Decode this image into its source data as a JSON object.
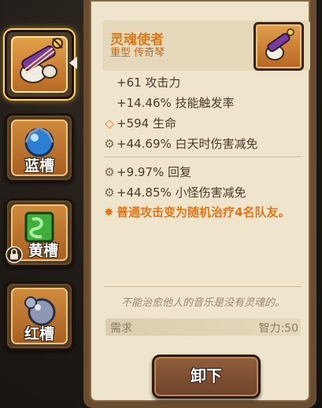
{
  "slots": [
    {
      "label": "",
      "icon": "lute-icon",
      "active": true
    },
    {
      "label": "蓝槽",
      "icon": "blue-gem-icon"
    },
    {
      "label": "黄槽",
      "icon": "green-gem-icon",
      "locked": true
    },
    {
      "label": "红槽",
      "icon": "gray-orb-icon"
    }
  ],
  "item": {
    "name": "灵魂使者",
    "type": "重型 传奇琴",
    "thumb_icon": "lute-icon"
  },
  "stats_main": [
    {
      "icon": "",
      "text": "+61 攻击力"
    },
    {
      "icon": "",
      "text": "+14.46% 技能触发率"
    },
    {
      "icon": "diamond-icon",
      "text": "+594 生命"
    },
    {
      "icon": "gear-icon",
      "text": "+44.69% 白天时伤害减免"
    }
  ],
  "stats_extra": [
    {
      "icon": "gear-icon",
      "text": "+9.97% 回复"
    },
    {
      "icon": "gear-icon",
      "text": "+44.85% 小怪伤害减免"
    }
  ],
  "special": {
    "icon": "star-icon",
    "text": "普通攻击变为随机治疗4名队友。"
  },
  "flavor": "不能治愈他人的音乐是没有灵魂的。",
  "requirement": {
    "label": "需求",
    "value": "智力:50"
  },
  "unequip_label": "卸下",
  "colors": {
    "accent": "#e0771a",
    "panel": "#efe4cc",
    "frame": "#6a4c30"
  }
}
